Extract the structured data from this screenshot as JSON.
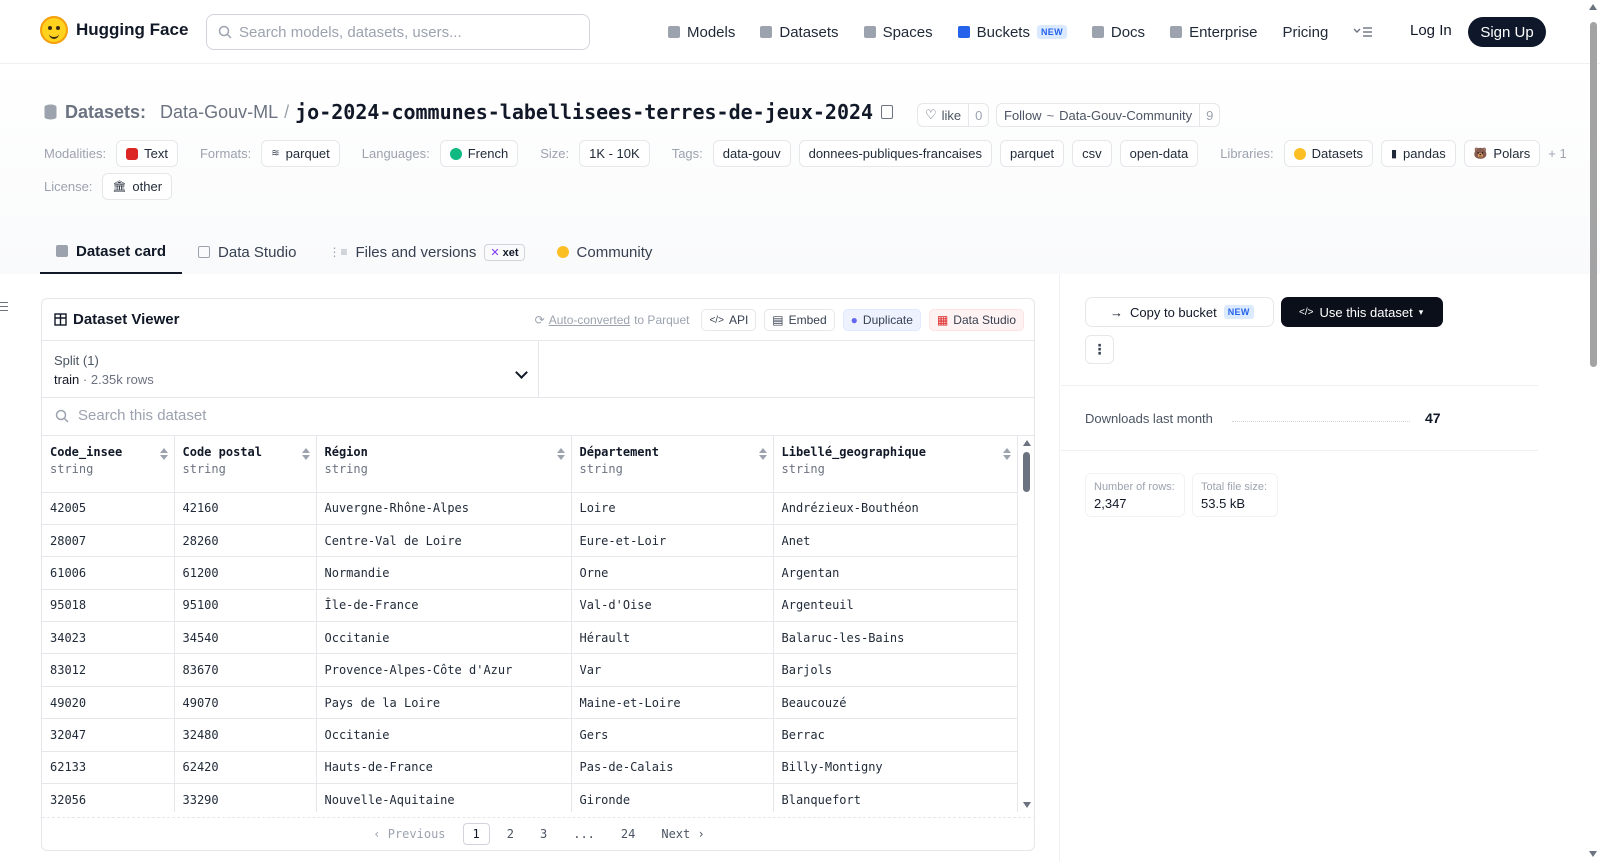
{
  "nav": {
    "brand": "Hugging Face",
    "search_placeholder": "Search models, datasets, users...",
    "links": [
      "Models",
      "Datasets",
      "Spaces",
      "Buckets",
      "Docs",
      "Enterprise",
      "Pricing"
    ],
    "buckets_badge": "NEW",
    "login": "Log In",
    "signup": "Sign Up"
  },
  "header": {
    "section": "Datasets:",
    "org": "Data-Gouv-ML",
    "separator": "/",
    "repo": "jo-2024-communes-labellisees-terres-de-jeux-2024",
    "like_label": "like",
    "like_count": "0",
    "follow_label": "Follow",
    "follow_org": "Data-Gouv-Community",
    "follow_count": "9"
  },
  "meta": {
    "modalities_label": "Modalities:",
    "modalities": [
      "Text"
    ],
    "formats_label": "Formats:",
    "formats": [
      "parquet"
    ],
    "languages_label": "Languages:",
    "languages": [
      "French"
    ],
    "size_label": "Size:",
    "size": "1K - 10K",
    "tags_label": "Tags:",
    "tags": [
      "data-gouv",
      "donnees-publiques-francaises",
      "parquet",
      "csv",
      "open-data"
    ],
    "libraries_label": "Libraries:",
    "libraries": [
      "Datasets",
      "pandas",
      "Polars"
    ],
    "libraries_more": "+ 1",
    "license_label": "License:",
    "license": "other"
  },
  "tabs": {
    "card": "Dataset card",
    "studio": "Data Studio",
    "files": "Files and versions",
    "xet": "xet",
    "community": "Community"
  },
  "viewer": {
    "title": "Dataset Viewer",
    "auto_converted": "Auto-converted",
    "to_parquet": "to Parquet",
    "api": "API",
    "embed": "Embed",
    "duplicate": "Duplicate",
    "data_studio": "Data Studio",
    "split_label": "Split (1)",
    "split_name": "train",
    "split_dot": "·",
    "split_rows": "2.35k rows",
    "search_placeholder": "Search this dataset",
    "columns": [
      {
        "name": "Code_insee",
        "type": "string"
      },
      {
        "name": "Code postal",
        "type": "string"
      },
      {
        "name": "Région",
        "type": "string"
      },
      {
        "name": "Département",
        "type": "string"
      },
      {
        "name": "Libellé_geographique",
        "type": "string"
      }
    ],
    "rows": [
      [
        "42005",
        "42160",
        "Auvergne-Rhône-Alpes",
        "Loire",
        "Andrézieux-Bouthéon"
      ],
      [
        "28007",
        "28260",
        "Centre-Val de Loire",
        "Eure-et-Loir",
        "Anet"
      ],
      [
        "61006",
        "61200",
        "Normandie",
        "Orne",
        "Argentan"
      ],
      [
        "95018",
        "95100",
        "Île-de-France",
        "Val-d'Oise",
        "Argenteuil"
      ],
      [
        "34023",
        "34540",
        "Occitanie",
        "Hérault",
        "Balaruc-les-Bains"
      ],
      [
        "83012",
        "83670",
        "Provence-Alpes-Côte d'Azur",
        "Var",
        "Barjols"
      ],
      [
        "49020",
        "49070",
        "Pays de la Loire",
        "Maine-et-Loire",
        "Beaucouzé"
      ],
      [
        "32047",
        "32480",
        "Occitanie",
        "Gers",
        "Berrac"
      ],
      [
        "62133",
        "62420",
        "Hauts-de-France",
        "Pas-de-Calais",
        "Billy-Montigny"
      ],
      [
        "32056",
        "33290",
        "Nouvelle-Aquitaine",
        "Gironde",
        "Blanquefort"
      ]
    ],
    "pager": {
      "previous": "‹ Previous",
      "pages": [
        "1",
        "2",
        "3",
        "...",
        "24"
      ],
      "next": "Next ›"
    }
  },
  "sidebar": {
    "copy_to_bucket": "Copy to bucket",
    "copy_badge": "NEW",
    "use_dataset": "Use this dataset",
    "more": "⋮",
    "downloads_label": "Downloads last month",
    "downloads_value": "47",
    "rows_label": "Number of rows:",
    "rows_value": "2,347",
    "size_label": "Total file size:",
    "size_value": "53.5 kB"
  }
}
